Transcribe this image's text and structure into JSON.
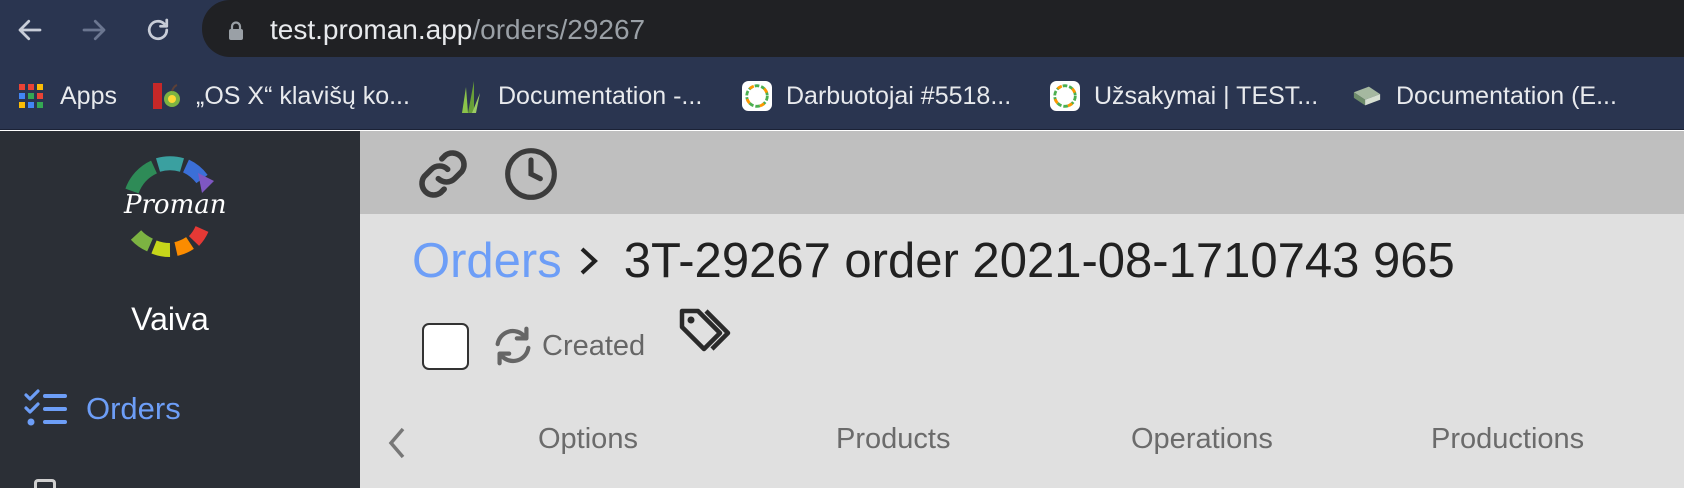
{
  "browser": {
    "url_host": "test.proman.app",
    "url_path": "/orders/29267",
    "bookmarks": [
      {
        "label": "Apps",
        "icon": "apps-grid-icon"
      },
      {
        "label": "„OS X“ klavišų ko...",
        "icon": "mac-apple-icon"
      },
      {
        "label": "Documentation -...",
        "icon": "grass-icon"
      },
      {
        "label": "Darbuotojai #5518...",
        "icon": "proman-favicon-icon"
      },
      {
        "label": "Užsakymai | TEST...",
        "icon": "proman-favicon-icon"
      },
      {
        "label": "Documentation (E...",
        "icon": "book-icon"
      }
    ]
  },
  "sidebar": {
    "logo_text": "Proman",
    "user_name": "Vaiva",
    "nav_orders": "Orders"
  },
  "toolbar": {
    "icons": [
      "link-icon",
      "clock-icon"
    ]
  },
  "breadcrumb": {
    "parent": "Orders",
    "title": "3T-29267 order 2021-08-1710743 965"
  },
  "status": {
    "label": "Created"
  },
  "tabs": [
    "Options",
    "Products",
    "Operations",
    "Productions"
  ],
  "colors": {
    "accent": "#6d9ef7",
    "sidebar_bg": "#2b2f36",
    "browser_chrome": "#2a3550"
  }
}
